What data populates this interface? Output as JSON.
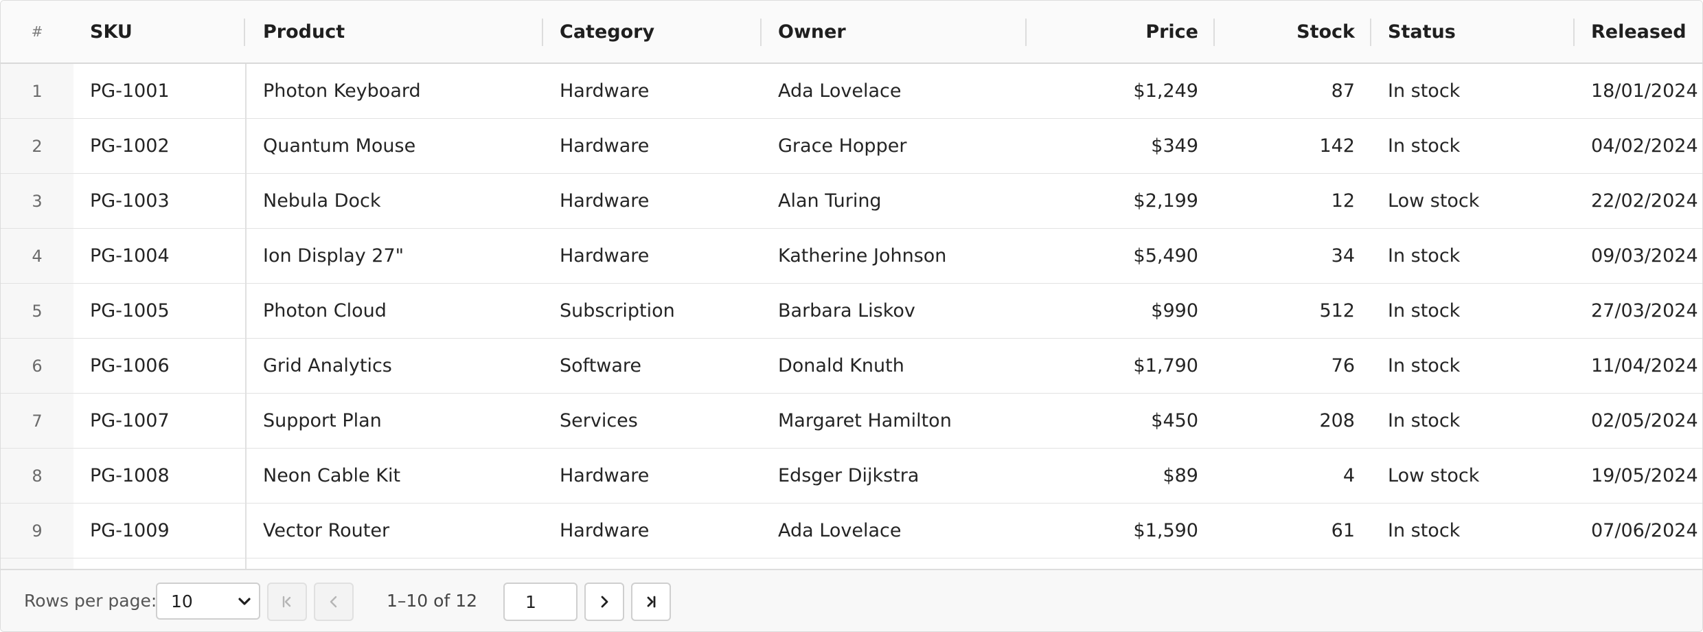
{
  "columns": {
    "num": "#",
    "sku": "SKU",
    "product": "Product",
    "category": "Category",
    "owner": "Owner",
    "price": "Price",
    "stock": "Stock",
    "status": "Status",
    "released": "Released"
  },
  "rows": [
    {
      "num": "1",
      "sku": "PG-1001",
      "product": "Photon Keyboard",
      "category": "Hardware",
      "owner": "Ada Lovelace",
      "price": "$1,249",
      "stock": "87",
      "status": "In stock",
      "released": "18/01/2024"
    },
    {
      "num": "2",
      "sku": "PG-1002",
      "product": "Quantum Mouse",
      "category": "Hardware",
      "owner": "Grace Hopper",
      "price": "$349",
      "stock": "142",
      "status": "In stock",
      "released": "04/02/2024"
    },
    {
      "num": "3",
      "sku": "PG-1003",
      "product": "Nebula Dock",
      "category": "Hardware",
      "owner": "Alan Turing",
      "price": "$2,199",
      "stock": "12",
      "status": "Low stock",
      "released": "22/02/2024"
    },
    {
      "num": "4",
      "sku": "PG-1004",
      "product": "Ion Display 27\"",
      "category": "Hardware",
      "owner": "Katherine Johnson",
      "price": "$5,490",
      "stock": "34",
      "status": "In stock",
      "released": "09/03/2024"
    },
    {
      "num": "5",
      "sku": "PG-1005",
      "product": "Photon Cloud",
      "category": "Subscription",
      "owner": "Barbara Liskov",
      "price": "$990",
      "stock": "512",
      "status": "In stock",
      "released": "27/03/2024"
    },
    {
      "num": "6",
      "sku": "PG-1006",
      "product": "Grid Analytics",
      "category": "Software",
      "owner": "Donald Knuth",
      "price": "$1,790",
      "stock": "76",
      "status": "In stock",
      "released": "11/04/2024"
    },
    {
      "num": "7",
      "sku": "PG-1007",
      "product": "Support Plan",
      "category": "Services",
      "owner": "Margaret Hamilton",
      "price": "$450",
      "stock": "208",
      "status": "In stock",
      "released": "02/05/2024"
    },
    {
      "num": "8",
      "sku": "PG-1008",
      "product": "Neon Cable Kit",
      "category": "Hardware",
      "owner": "Edsger Dijkstra",
      "price": "$89",
      "stock": "4",
      "status": "Low stock",
      "released": "19/05/2024"
    },
    {
      "num": "9",
      "sku": "PG-1009",
      "product": "Vector Router",
      "category": "Hardware",
      "owner": "Ada Lovelace",
      "price": "$1,590",
      "stock": "61",
      "status": "In stock",
      "released": "07/06/2024"
    }
  ],
  "pagination": {
    "rows_per_page_label": "Rows per page:",
    "rows_per_page_value": "10",
    "range_text": "1–10 of 12",
    "current_page": "1",
    "icons": {
      "first": "first-page-icon",
      "prev": "chevron-left-icon",
      "next": "chevron-right-icon",
      "last": "last-page-icon",
      "select": "chevron-down-icon"
    }
  },
  "colors": {
    "header_bg": "#fafafa",
    "border": "#dcdcdc",
    "text": "#242424",
    "muted": "#6b6b6b"
  }
}
